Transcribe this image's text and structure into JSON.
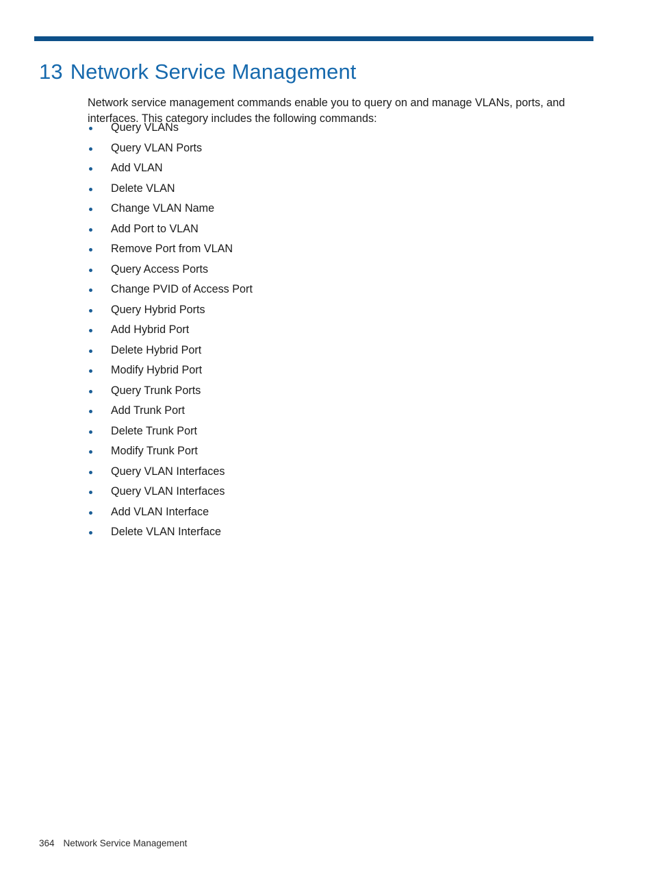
{
  "document": {
    "chapter": {
      "number": "13",
      "title": "Network Service Management",
      "heading_full": "13 Network Service Management"
    },
    "intro_paragraph": "Network service management commands enable you to query on and manage VLANs, ports, and interfaces. This category includes the following commands:",
    "command_list": [
      {
        "label": "Query VLANs"
      },
      {
        "label": "Query VLAN Ports"
      },
      {
        "label": "Add VLAN"
      },
      {
        "label": "Delete VLAN"
      },
      {
        "label": "Change VLAN Name"
      },
      {
        "label": "Add Port to VLAN"
      },
      {
        "label": "Remove Port from VLAN"
      },
      {
        "label": "Query Access Ports"
      },
      {
        "label": "Change PVID of Access Port"
      },
      {
        "label": "Query Hybrid Ports"
      },
      {
        "label": "Add Hybrid Port"
      },
      {
        "label": "Delete Hybrid Port"
      },
      {
        "label": "Modify Hybrid Port"
      },
      {
        "label": "Query Trunk Ports"
      },
      {
        "label": "Add Trunk Port"
      },
      {
        "label": "Delete Trunk Port"
      },
      {
        "label": "Modify Trunk Port"
      },
      {
        "label": "Query VLAN Interfaces"
      },
      {
        "label": "Query VLAN Interfaces"
      },
      {
        "label": "Add VLAN Interface"
      },
      {
        "label": "Delete VLAN Interface"
      }
    ],
    "footer": {
      "page_number": "364",
      "running_title": "Network Service Management"
    },
    "colors": {
      "rule": "#0d5089",
      "chapter_title": "#1669ad",
      "bullet": "#1b5e96",
      "body_text": "#1a1a1a",
      "page_background": "#ffffff"
    }
  }
}
